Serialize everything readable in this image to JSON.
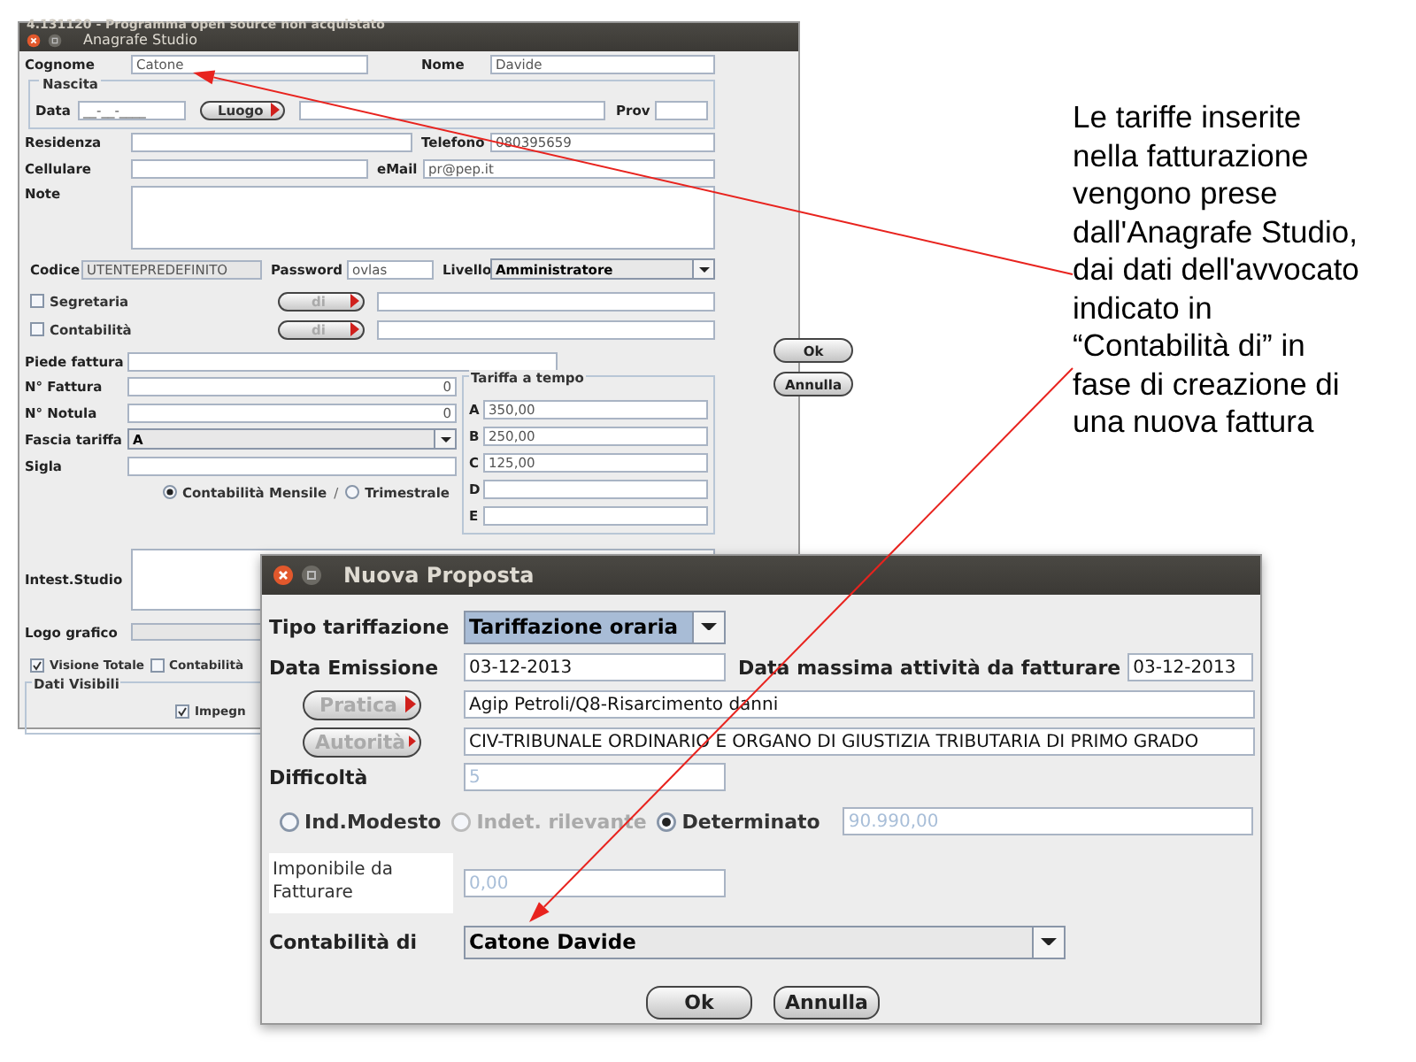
{
  "anagrafe": {
    "app_title": "4.131120 - Programma open source non acquistato",
    "title": "Anagrafe Studio",
    "cognome": {
      "label": "Cognome",
      "value": "Catone"
    },
    "nome": {
      "label": "Nome",
      "value": "Davide"
    },
    "nascita": {
      "legend": "Nascita",
      "data_label": "Data",
      "data_value": "__-__-____",
      "luogo_button": "Luogo",
      "prov_label": "Prov"
    },
    "residenza": {
      "label": "Residenza"
    },
    "telefono": {
      "label": "Telefono",
      "value": "080395659"
    },
    "cellulare": {
      "label": "Cellulare"
    },
    "email": {
      "label": "eMail",
      "value": "pr@pep.it"
    },
    "note": {
      "label": "Note"
    },
    "codice": {
      "label": "Codice",
      "value": "UTENTEPREDEFINITO"
    },
    "password": {
      "label": "Password",
      "value": "ovlas"
    },
    "livello": {
      "label": "Livello",
      "value": "Amministratore"
    },
    "links": [
      {
        "label": "Segretaria",
        "checked": false,
        "button": "di"
      },
      {
        "label": "Contabilità",
        "checked": false,
        "button": "di"
      }
    ],
    "buttons": [
      "Ok",
      "Annulla"
    ],
    "piede_fattura": {
      "label": "Piede fattura"
    },
    "n_fattura": {
      "label": "N° Fattura",
      "value": "0"
    },
    "n_notula": {
      "label": "N° Notula",
      "value": "0"
    },
    "fascia_tariffa": {
      "label": "Fascia tariffa",
      "value": "A"
    },
    "sigla": {
      "label": "Sigla"
    },
    "periodicity": [
      {
        "label": "Contabilità Mensile",
        "selected": true
      },
      {
        "label": "Trimestrale",
        "selected": false
      }
    ],
    "separator": "/",
    "tariffa_a_tempo": {
      "legend": "Tariffa a tempo",
      "rates": [
        {
          "letter": "A",
          "value": "350,00"
        },
        {
          "letter": "B",
          "value": "250,00"
        },
        {
          "letter": "C",
          "value": "125,00"
        },
        {
          "letter": "D"
        },
        {
          "letter": "E"
        }
      ]
    },
    "intest_studio": {
      "label": "Intest.Studio"
    },
    "logo_grafico": {
      "label": "Logo grafico"
    },
    "visibility": [
      {
        "label": "Visione Totale",
        "checked": true
      },
      {
        "label": "Contabilità",
        "checked": false
      }
    ],
    "dati_visibili": {
      "legend": "Dati Visibili",
      "items": [
        {
          "label": "Impegn",
          "checked": true
        }
      ]
    }
  },
  "nuova_proposta": {
    "title": "Nuova Proposta",
    "tipo_tariffazione": {
      "label": "Tipo tariffazione",
      "value": "Tariffazione oraria"
    },
    "data_emissione": {
      "label": "Data Emissione",
      "value": "03-12-2013"
    },
    "data_massima": {
      "label": "Data massima attività da fatturare",
      "value": "03-12-2013"
    },
    "pratica": {
      "button": "Pratica",
      "value": "Agip Petroli/Q8-Risarcimento danni"
    },
    "autorita": {
      "button": "Autorità",
      "value": "CIV-TRIBUNALE ORDINARIO E ORGANO DI GIUSTIZIA TRIBUTARIA DI PRIMO GRADO"
    },
    "difficolta": {
      "label": "Difficoltà",
      "value": "5"
    },
    "valore": [
      {
        "label": "Ind.Modesto",
        "selected": false,
        "disabled": false
      },
      {
        "label": "Indet. rilevante",
        "selected": false,
        "disabled": true
      },
      {
        "label": "Determinato",
        "selected": true,
        "disabled": false
      }
    ],
    "valore_value": "90.990,00",
    "imponibile": {
      "label": "Imponibile da Fatturare",
      "value": "0,00"
    },
    "contabilita_di": {
      "label": "Contabilità di",
      "value": "Catone Davide"
    },
    "buttons": [
      "Ok",
      "Annulla"
    ]
  },
  "annotation": {
    "lines": [
      "Le tariffe inserite",
      "nella fatturazione",
      "vengono prese",
      "dall'Anagrafe Studio,",
      "dai dati dell'avvocato",
      "indicato in",
      "“Contabilità di” in",
      "fase di creazione di",
      "una nuova fattura"
    ]
  }
}
